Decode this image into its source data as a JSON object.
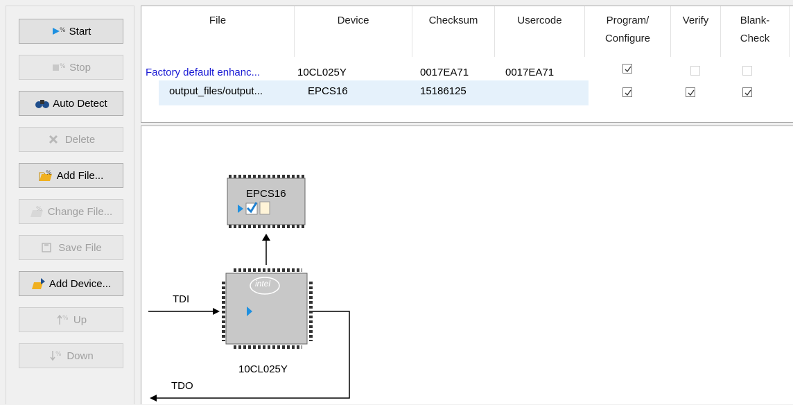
{
  "toolbar": {
    "start": "Start",
    "stop": "Stop",
    "auto_detect": "Auto Detect",
    "delete": "Delete",
    "add_file": "Add File...",
    "change_file": "Change File...",
    "save_file": "Save File",
    "add_device": "Add Device...",
    "up": "Up",
    "down": "Down"
  },
  "table": {
    "headers": {
      "file": "File",
      "device": "Device",
      "checksum": "Checksum",
      "usercode": "Usercode",
      "program_line1": "Program/",
      "program_line2": "Configure",
      "verify": "Verify",
      "blank_line1": "Blank-",
      "blank_line2": "Check"
    },
    "rows": [
      {
        "file": "Factory default enhanc...",
        "device": "10CL025Y",
        "checksum": "0017EA71",
        "usercode": "0017EA71",
        "program": true,
        "verify": false,
        "blank_check": false
      },
      {
        "file": "output_files/output...",
        "device": "EPCS16",
        "checksum": "15186125",
        "usercode": "",
        "program": true,
        "verify": true,
        "blank_check": true
      }
    ]
  },
  "diagram": {
    "flash_device": "EPCS16",
    "fpga_device": "10CL025Y",
    "fpga_logo": "intel",
    "tdi_label": "TDI",
    "tdo_label": "TDO"
  },
  "colors": {
    "link_blue": "#1a1ad4",
    "selection": "#e5f1fb",
    "chip_fill": "#c8c8c8",
    "play_blue": "#1e90e0"
  }
}
